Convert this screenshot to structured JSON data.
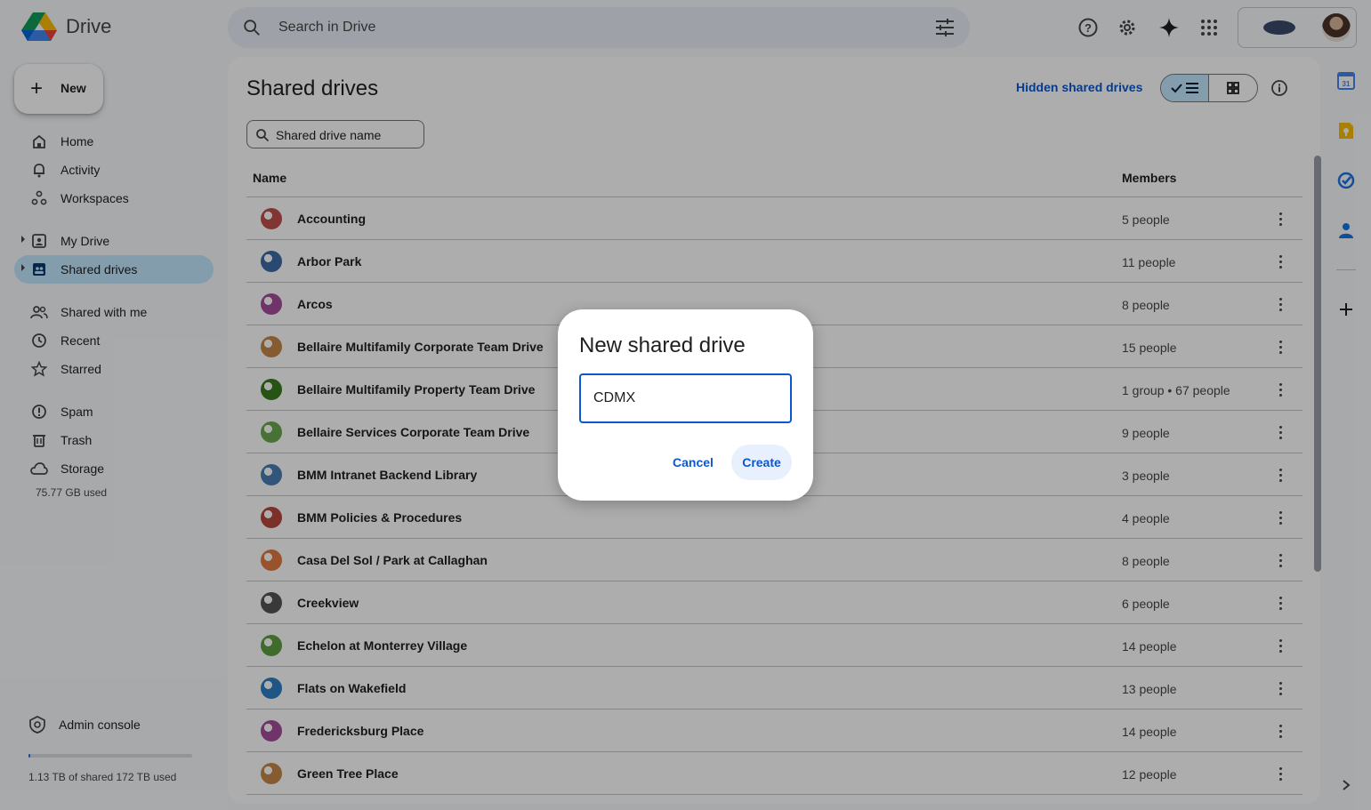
{
  "app": {
    "name": "Drive"
  },
  "search": {
    "placeholder": "Search in Drive"
  },
  "sidebar": {
    "new_label": "New",
    "items": [
      {
        "label": "Home",
        "icon": "home-icon"
      },
      {
        "label": "Activity",
        "icon": "bell-icon"
      },
      {
        "label": "Workspaces",
        "icon": "workspaces-icon"
      },
      {
        "label": "My Drive",
        "icon": "my-drive-icon"
      },
      {
        "label": "Shared drives",
        "icon": "shared-drives-icon",
        "active": true
      },
      {
        "label": "Shared with me",
        "icon": "people-icon"
      },
      {
        "label": "Recent",
        "icon": "clock-icon"
      },
      {
        "label": "Starred",
        "icon": "star-icon"
      },
      {
        "label": "Spam",
        "icon": "spam-icon"
      },
      {
        "label": "Trash",
        "icon": "trash-icon"
      },
      {
        "label": "Storage",
        "icon": "cloud-icon"
      }
    ],
    "storage_used": "75.77 GB used",
    "admin_label": "Admin console",
    "shared_quota_text": "1.13 TB of shared 172 TB used",
    "shared_quota_fraction": 0.0066
  },
  "main": {
    "title": "Shared drives",
    "hidden_link": "Hidden shared drives",
    "filter_placeholder": "Shared drive name",
    "columns": {
      "name": "Name",
      "members": "Members"
    },
    "drives": [
      {
        "name": "Accounting",
        "members": "5 people",
        "color": "#c0504d"
      },
      {
        "name": "Arbor Park",
        "members": "11 people",
        "color": "#3d6aa8"
      },
      {
        "name": "Arcos",
        "members": "8 people",
        "color": "#a64d9e"
      },
      {
        "name": "Bellaire Multifamily Corporate Team Drive",
        "members": "15 people",
        "color": "#c8874a"
      },
      {
        "name": "Bellaire Multifamily Property Team Drive",
        "members": "1 group • 67 people",
        "color": "#3a7d1e"
      },
      {
        "name": "Bellaire Services Corporate Team Drive",
        "members": "9 people",
        "color": "#6aa84f"
      },
      {
        "name": "BMM Intranet Backend Library",
        "members": "3 people",
        "color": "#4a7fb5"
      },
      {
        "name": "BMM Policies & Procedures",
        "members": "4 people",
        "color": "#b5473b"
      },
      {
        "name": "Casa Del Sol / Park at Callaghan",
        "members": "8 people",
        "color": "#e07a42"
      },
      {
        "name": "Creekview",
        "members": "6 people",
        "color": "#555555"
      },
      {
        "name": "Echelon at Monterrey Village",
        "members": "14 people",
        "color": "#5ea03e"
      },
      {
        "name": "Flats on Wakefield",
        "members": "13 people",
        "color": "#2f7fc4"
      },
      {
        "name": "Fredericksburg Place",
        "members": "14 people",
        "color": "#a64d9e"
      },
      {
        "name": "Green Tree Place",
        "members": "12 people",
        "color": "#c8874a"
      }
    ]
  },
  "dialog": {
    "title": "New shared drive",
    "input_value": "CDMX",
    "cancel_label": "Cancel",
    "create_label": "Create"
  },
  "colors": {
    "accent": "#0b57d0",
    "active_nav": "#c2e7ff",
    "background": "#f8fafd"
  }
}
